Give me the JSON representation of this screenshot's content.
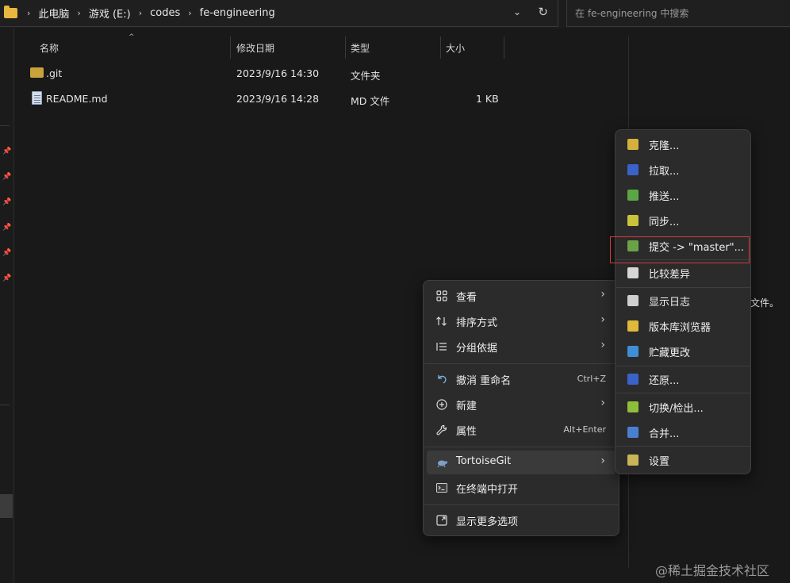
{
  "address_bar": {
    "crumbs": [
      "此电脑",
      "游戏 (E:)",
      "codes",
      "fe-engineering"
    ],
    "dropdown_glyph": "⌄",
    "refresh_glyph": "↻"
  },
  "search": {
    "placeholder": "在 fe-engineering 中搜索"
  },
  "columns": {
    "name": "名称",
    "modified": "修改日期",
    "type": "类型",
    "size": "大小"
  },
  "files": [
    {
      "name": ".git",
      "modified": "2023/9/16 14:30",
      "type": "文件夹",
      "size": "",
      "icon": "folder-icon"
    },
    {
      "name": "README.md",
      "modified": "2023/9/16 14:28",
      "type": "MD 文件",
      "size": "1 KB",
      "icon": "markdown-file-icon"
    }
  ],
  "details_pane": {
    "text": "文件。"
  },
  "context_menu": {
    "view": {
      "label": "查看",
      "icon": "grid-icon"
    },
    "sort": {
      "label": "排序方式",
      "icon": "sort-icon"
    },
    "group": {
      "label": "分组依据",
      "icon": "group-icon"
    },
    "undo": {
      "label": "撤消 重命名",
      "shortcut": "Ctrl+Z",
      "icon": "undo-icon"
    },
    "new": {
      "label": "新建",
      "icon": "plus-circle-icon"
    },
    "properties": {
      "label": "属性",
      "shortcut": "Alt+Enter",
      "icon": "wrench-icon"
    },
    "tortoise": {
      "label": "TortoiseGit",
      "icon": "tortoise-icon"
    },
    "terminal": {
      "label": "在终端中打开",
      "icon": "terminal-icon"
    },
    "more": {
      "label": "显示更多选项",
      "icon": "more-options-icon"
    },
    "chevron": "›"
  },
  "tortoise_menu": {
    "items": [
      {
        "label": "克隆...",
        "icon": "clone-icon",
        "color": "#d4b13c"
      },
      {
        "label": "拉取...",
        "icon": "pull-icon",
        "color": "#3a63c9"
      },
      {
        "label": "推送...",
        "icon": "push-icon",
        "color": "#5aa845"
      },
      {
        "label": "同步...",
        "icon": "sync-icon",
        "color": "#c9c43a"
      },
      {
        "label": "提交 -> \"master\"...",
        "icon": "commit-icon",
        "color": "#6aa347"
      },
      {
        "label": "比较差异",
        "icon": "diff-icon",
        "color": "#d6d6d6"
      },
      {
        "label": "显示日志",
        "icon": "log-icon",
        "color": "#cfcfcf"
      },
      {
        "label": "版本库浏览器",
        "icon": "repo-browser-icon",
        "color": "#e0b83a"
      },
      {
        "label": "贮藏更改",
        "icon": "stash-icon",
        "color": "#3f8fd6"
      },
      {
        "label": "还原...",
        "icon": "revert-icon",
        "color": "#3a63c9"
      },
      {
        "label": "切换/检出...",
        "icon": "switch-icon",
        "color": "#8fbf3a"
      },
      {
        "label": "合并...",
        "icon": "merge-icon",
        "color": "#4a7fd0"
      },
      {
        "label": "设置",
        "icon": "settings-icon",
        "color": "#c9b45a"
      }
    ]
  },
  "watermark": "@稀土掘金技术社区"
}
